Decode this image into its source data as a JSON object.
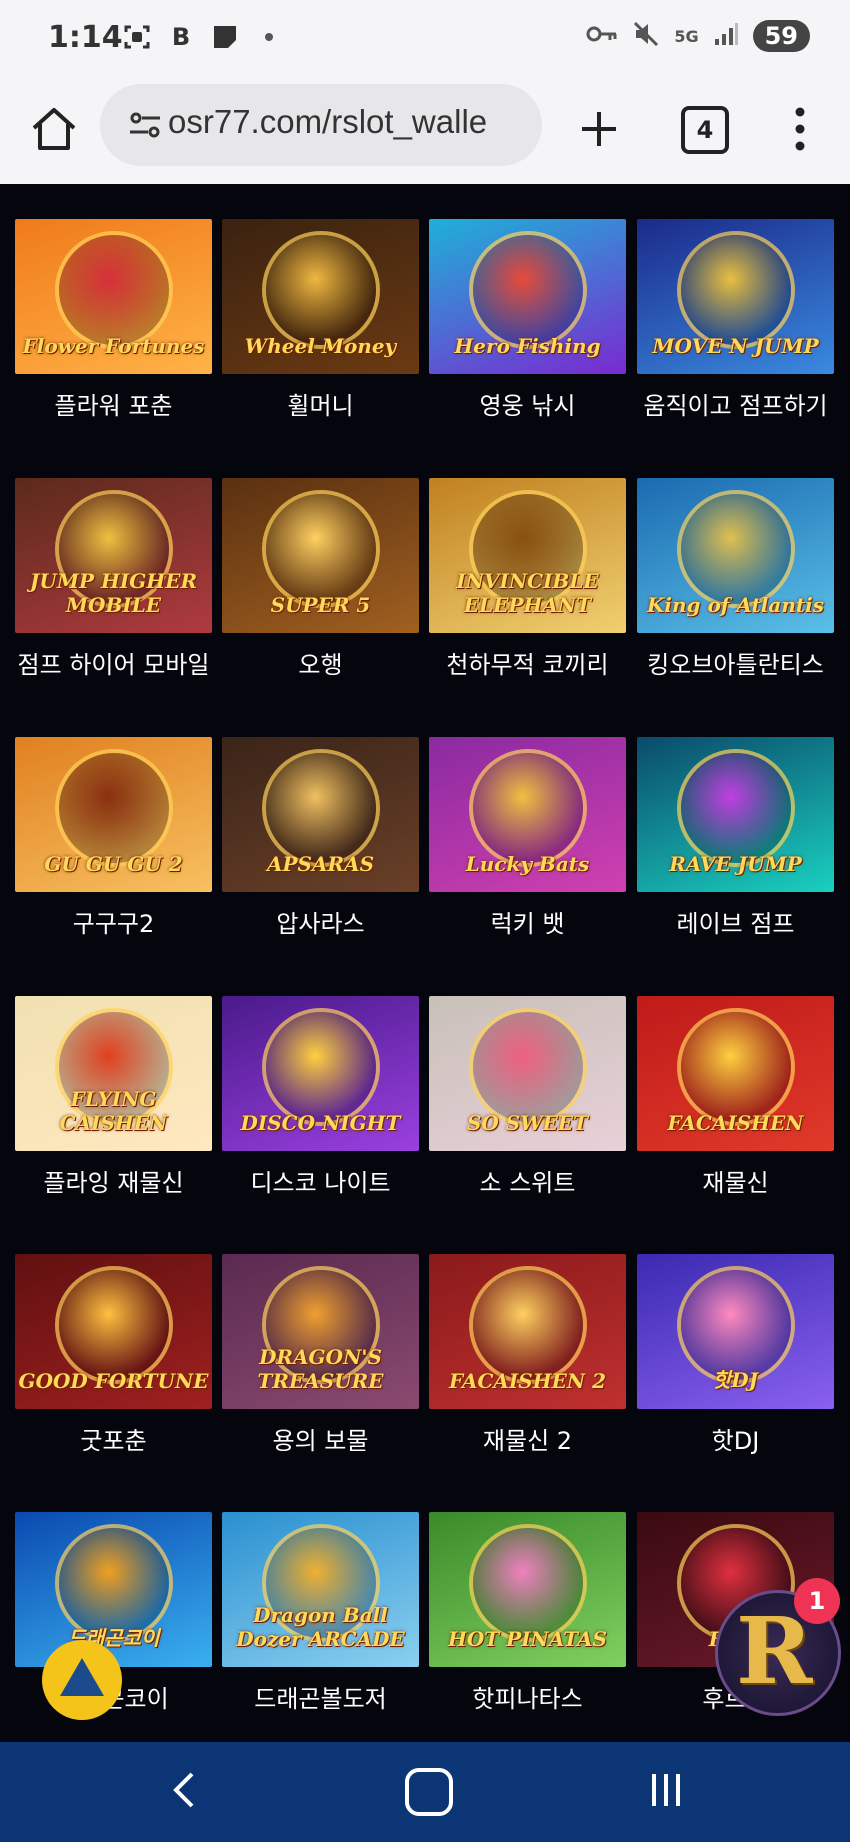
{
  "status_bar": {
    "time": "1:14",
    "battery": "59",
    "network": "5G"
  },
  "browser": {
    "url": "osr77.com/rslot_walle",
    "tab_count": "4"
  },
  "games": [
    {
      "name": "플라워 포춘",
      "logo": "Flower Fortunes"
    },
    {
      "name": "휠머니",
      "logo": "Wheel Money"
    },
    {
      "name": "영웅 낚시",
      "logo": "Hero Fishing"
    },
    {
      "name": "움직이고 점프하기",
      "logo": "MOVE N JUMP"
    },
    {
      "name": "점프 하이어 모바일",
      "logo": "JUMP HIGHER MOBILE"
    },
    {
      "name": "오행",
      "logo": "SUPER 5"
    },
    {
      "name": "천하무적 코끼리",
      "logo": "INVINCIBLE ELEPHANT"
    },
    {
      "name": "킹오브아틀란티스",
      "logo": "King of Atlantis"
    },
    {
      "name": "구구구2",
      "logo": "GU GU GU 2"
    },
    {
      "name": "압사라스",
      "logo": "APSARAS"
    },
    {
      "name": "럭키 뱃",
      "logo": "Lucky Bats"
    },
    {
      "name": "레이브 점프",
      "logo": "RAVE JUMP"
    },
    {
      "name": "플라잉 재물신",
      "logo": "FLYING CAISHEN"
    },
    {
      "name": "디스코 나이트",
      "logo": "DISCO NIGHT"
    },
    {
      "name": "소 스위트",
      "logo": "SO SWEET"
    },
    {
      "name": "재물신",
      "logo": "FACAISHEN"
    },
    {
      "name": "굿포춘",
      "logo": "GOOD FORTUNE"
    },
    {
      "name": "용의 보물",
      "logo": "DRAGON'S TREASURE"
    },
    {
      "name": "재물신 2",
      "logo": "FACAISHEN 2"
    },
    {
      "name": "핫DJ",
      "logo": "핫DJ"
    },
    {
      "name": "드래곤코이",
      "logo": "드래곤코이"
    },
    {
      "name": "드래곤볼도저",
      "logo": "Dragon Ball Dozer ARCADE"
    },
    {
      "name": "핫피나타스",
      "logo": "HOT PINATAS"
    },
    {
      "name": "후르츠",
      "logo": "FT K"
    }
  ],
  "floating": {
    "notification_count": "1",
    "brand_letter": "R"
  },
  "theme": {
    "page_bg": "#05060d",
    "nav_bar": "#0c3575",
    "badge": "#ee3355",
    "fab_up": "#f4c41a"
  }
}
